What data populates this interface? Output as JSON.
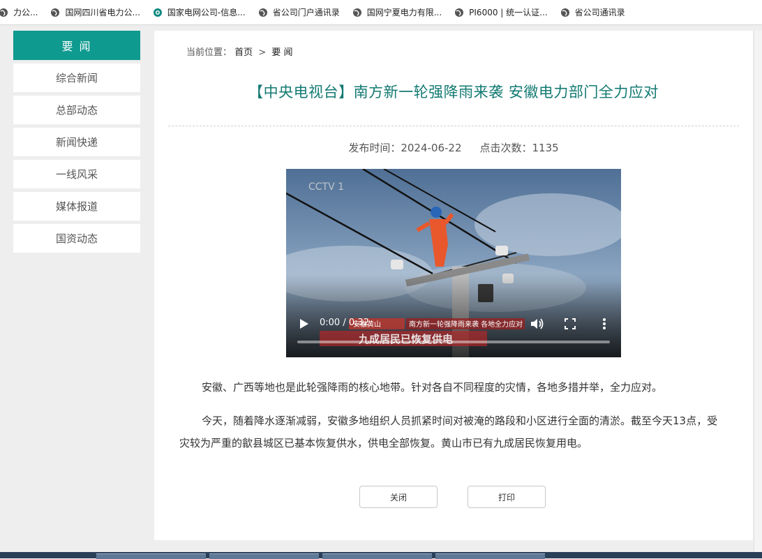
{
  "bookmarks": [
    {
      "label": "力公...",
      "icon": "globe-icon"
    },
    {
      "label": "国网四川省电力公...",
      "icon": "globe-icon"
    },
    {
      "label": "国家电网公司-信息...",
      "icon": "sgcc-logo-icon"
    },
    {
      "label": "省公司门户通讯录",
      "icon": "globe-icon"
    },
    {
      "label": "国网宁夏电力有限...",
      "icon": "globe-icon"
    },
    {
      "label": "PI6000 | 统一认证...",
      "icon": "globe-icon"
    },
    {
      "label": "省公司通讯录",
      "icon": "globe-icon"
    }
  ],
  "sidebar": {
    "header": "要 闻",
    "items": [
      {
        "label": "综合新闻"
      },
      {
        "label": "总部动态"
      },
      {
        "label": "新闻快递"
      },
      {
        "label": "一线风采"
      },
      {
        "label": "媒体报道"
      },
      {
        "label": "国资动态"
      }
    ]
  },
  "breadcrumb": {
    "prefix": "当前位置：",
    "home": "首页",
    "separator": ">",
    "current": "要 闻"
  },
  "article": {
    "title": "【中央电视台】南方新一轮强降雨来袭 安徽电力部门全力应对",
    "publish_label": "发布时间：2024-06-22",
    "views_label": "点击次数：1135",
    "paragraphs": [
      "安徽、广西等地也是此轮强降雨的核心地带。针对各自不同程度的灾情，各地多措并举，全力应对。",
      "今天，随着降水逐渐减弱，安徽多地组织人员抓紧时间对被淹的路段和小区进行全面的清淤。截至今天13点，受灾较为严重的歙县城区已基本恢复供水，供电全部恢复。黄山市已有九成居民恢复用电。"
    ]
  },
  "video": {
    "time": "0:00 / 0:32",
    "progress": 0,
    "channel_logo": "CCTV 1",
    "ticker_left": "安徽黄山",
    "ticker_right": "南方新一轮强降雨来袭 各地全力应对",
    "caption": "九成居民已恢复供电"
  },
  "actions": {
    "close_label": "关闭",
    "print_label": "打印"
  },
  "colors": {
    "accent": "#0e9a8f",
    "title": "#127a72"
  }
}
